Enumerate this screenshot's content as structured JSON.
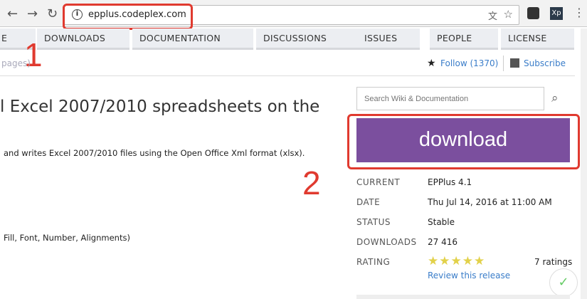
{
  "browser": {
    "url": "epplus.codeplex.com",
    "ext1": "Xp"
  },
  "tabs": [
    "E",
    "DOWNLOADS",
    "DOCUMENTATION",
    "DISCUSSIONS",
    "ISSUES",
    "PEOPLE",
    "LICENSE"
  ],
  "pages_link": "pages)",
  "follow": "Follow (1370)",
  "subscribe": "Subscribe",
  "search": {
    "placeholder": "Search Wiki & Documentation"
  },
  "title": "l Excel 2007/2010 spreadsheets on the",
  "desc": "and writes Excel 2007/2010 files using the Open Office Xml format (xlsx).",
  "feature": "Fill, Font, Number, Alignments)",
  "download": "download",
  "annotations": [
    "1",
    "2"
  ],
  "release": {
    "current_label": "CURRENT",
    "current": "EPPlus 4.1",
    "date_label": "DATE",
    "date": "Thu Jul 14, 2016 at 11:00 AM",
    "status_label": "STATUS",
    "status": "Stable",
    "downloads_label": "DOWNLOADS",
    "downloads": "27 416",
    "rating_label": "RATING",
    "rating": 5,
    "ratings": "7 ratings",
    "review": "Review this release"
  },
  "colors": {
    "download": "#7b4f9e",
    "annotation": "#e03a2f",
    "link": "#3a7dc9",
    "star": "#e2d14a"
  }
}
